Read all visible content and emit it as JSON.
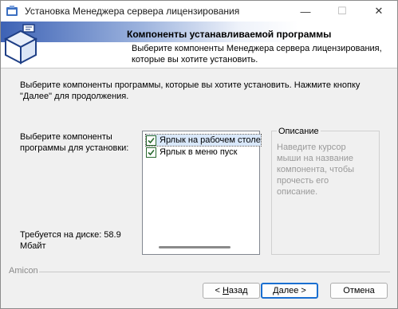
{
  "window": {
    "title": "Установка Менеджера сервера лицензирования"
  },
  "titlebar_buttons": {
    "minimize": "—",
    "maximize": "☐",
    "close": "✕"
  },
  "header": {
    "title": "Компоненты устанавливаемой программы",
    "description_line1": "Выберите компоненты Менеджера сервера лицензирования,",
    "description_line2": "которые вы хотите установить."
  },
  "intro": {
    "line1": "Выберите компоненты программы, которые вы хотите установить. Нажмите кнопку",
    "line2": "\"Далее\" для продолжения."
  },
  "components": {
    "label_line1": "Выберите компоненты",
    "label_line2": "программы для установки:",
    "items": [
      {
        "label": "Ярлык на рабочем столе",
        "checked": true,
        "selected": true
      },
      {
        "label": "Ярлык в меню пуск",
        "checked": true,
        "selected": false
      }
    ]
  },
  "disk": {
    "line1": "Требуется на диске: 58.9",
    "line2": "Мбайт"
  },
  "description": {
    "legend": "Описание",
    "text": "Наведите курсор мыши на название компонента, чтобы прочесть его описание."
  },
  "footer": {
    "brand": "Amicon"
  },
  "buttons": {
    "back_underlined": "Н",
    "back_rest": "азад",
    "next_underlined": "Д",
    "next_rest": "алее",
    "cancel": "Отмена"
  },
  "colors": {
    "accent": "#1a6fd1",
    "header_band": "#3d62b5",
    "checkbox": "#2a6a30"
  }
}
